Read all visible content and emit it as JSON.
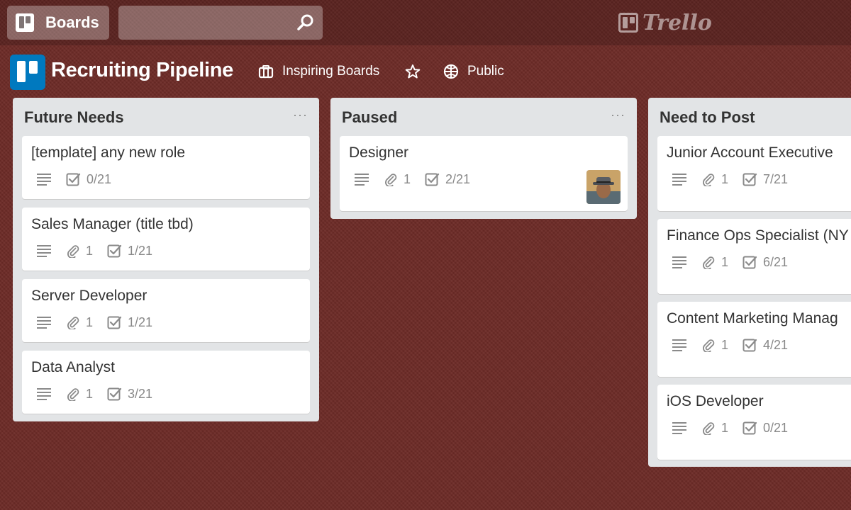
{
  "nav": {
    "boards_label": "Boards",
    "search_value": "",
    "logo_text": "Trello"
  },
  "board": {
    "title": "Recruiting Pipeline",
    "team": "Inspiring Boards",
    "visibility": "Public",
    "icon_color": "#0079bf"
  },
  "lists": [
    {
      "title": "Future Needs",
      "menu": "···",
      "cards": [
        {
          "title": "[template] any new role",
          "desc": true,
          "attachments": null,
          "checklist": "0/21"
        },
        {
          "title": "Sales Manager (title tbd)",
          "desc": true,
          "attachments": "1",
          "checklist": "1/21"
        },
        {
          "title": "Server Developer",
          "desc": true,
          "attachments": "1",
          "checklist": "1/21"
        },
        {
          "title": "Data Analyst",
          "desc": true,
          "attachments": "1",
          "checklist": "3/21"
        }
      ]
    },
    {
      "title": "Paused",
      "menu": "···",
      "cards": [
        {
          "title": "Designer",
          "desc": true,
          "attachments": "1",
          "checklist": "2/21",
          "avatar": "member-avatar"
        }
      ]
    },
    {
      "title": "Need to Post",
      "menu": "···",
      "cards": [
        {
          "title": "Junior Account Executive",
          "desc": true,
          "attachments": "1",
          "checklist": "7/21"
        },
        {
          "title": "Finance Ops Specialist (NY",
          "desc": true,
          "attachments": "1",
          "checklist": "6/21"
        },
        {
          "title": "Content Marketing Manag",
          "desc": true,
          "attachments": "1",
          "checklist": "4/21"
        },
        {
          "title": "iOS Developer",
          "desc": true,
          "attachments": "1",
          "checklist": "0/21"
        }
      ]
    }
  ],
  "icons": {
    "boards": "boards-icon",
    "search": "search-icon",
    "team": "team-icon",
    "star": "star-icon",
    "visibility": "globe-icon",
    "description": "description-icon",
    "attachment": "paperclip-icon",
    "checklist": "checklist-icon"
  }
}
